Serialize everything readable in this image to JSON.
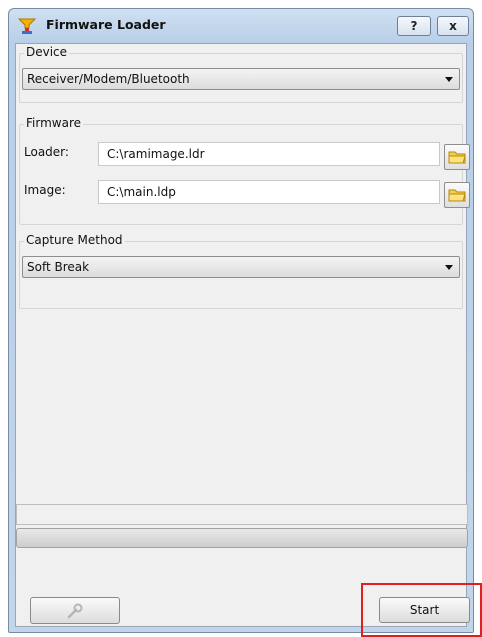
{
  "window": {
    "title": "Firmware Loader",
    "help_label": "?",
    "close_label": "x"
  },
  "device": {
    "group_label": "Device",
    "selected": "Receiver/Modem/Bluetooth"
  },
  "firmware": {
    "group_label": "Firmware",
    "loader_label": "Loader:",
    "loader_value": "C:\\ramimage.ldr",
    "image_label": "Image:",
    "image_value": "C:\\main.ldp"
  },
  "capture": {
    "group_label": "Capture Method",
    "selected": "Soft Break"
  },
  "footer": {
    "start_label": "Start"
  },
  "colors": {
    "highlight": "#e02020",
    "folder": "#f3cd4a"
  }
}
